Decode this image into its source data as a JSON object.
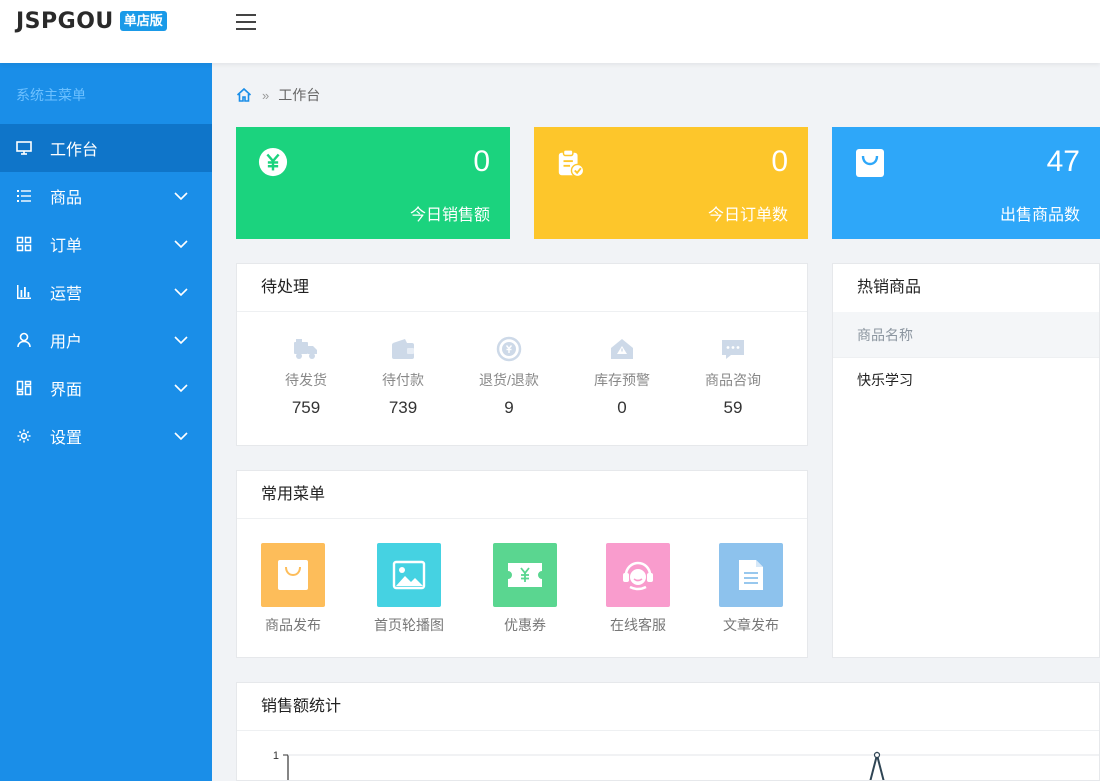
{
  "app": {
    "logo_text": "JSPGOU",
    "logo_badge": "单店版",
    "brand_color": "#1a8ee8"
  },
  "sidebar": {
    "title": "系统主菜单",
    "items": [
      {
        "label": "工作台",
        "icon": "monitor-icon",
        "active": true
      },
      {
        "label": "商品",
        "icon": "list-icon"
      },
      {
        "label": "订单",
        "icon": "grid-icon"
      },
      {
        "label": "运营",
        "icon": "bar-chart-icon"
      },
      {
        "label": "用户",
        "icon": "user-icon"
      },
      {
        "label": "界面",
        "icon": "layout-icon"
      },
      {
        "label": "设置",
        "icon": "gear-icon"
      }
    ]
  },
  "breadcrumb": {
    "icon": "home-icon",
    "separator": "»",
    "current": "工作台"
  },
  "stats": [
    {
      "value": "0",
      "label": "今日销售额",
      "color": "#1bd37e",
      "icon": "yen-icon"
    },
    {
      "value": "0",
      "label": "今日订单数",
      "color": "#fdc62b",
      "icon": "clipboard-check-icon"
    },
    {
      "value": "47",
      "label": "出售商品数",
      "color": "#2ea7f9",
      "icon": "shopping-bag-icon"
    }
  ],
  "pending": {
    "title": "待处理",
    "items": [
      {
        "label": "待发货",
        "value": "759",
        "icon": "truck-icon"
      },
      {
        "label": "待付款",
        "value": "739",
        "icon": "wallet-icon"
      },
      {
        "label": "退货/退款",
        "value": "9",
        "icon": "refund-icon"
      },
      {
        "label": "库存预警",
        "value": "0",
        "icon": "warning-icon"
      },
      {
        "label": "商品咨询",
        "value": "59",
        "icon": "chat-icon"
      }
    ]
  },
  "quick_menu": {
    "title": "常用菜单",
    "items": [
      {
        "label": "商品发布",
        "color": "#fdbd5a",
        "icon": "bag-icon"
      },
      {
        "label": "首页轮播图",
        "color": "#45d2e2",
        "icon": "image-icon"
      },
      {
        "label": "优惠券",
        "color": "#5ad690",
        "icon": "coupon-icon"
      },
      {
        "label": "在线客服",
        "color": "#f99ccd",
        "icon": "support-icon"
      },
      {
        "label": "文章发布",
        "color": "#8dc2ed",
        "icon": "document-icon"
      }
    ]
  },
  "hot_products": {
    "title": "热销商品",
    "column": "商品名称",
    "rows": [
      "快乐学习"
    ]
  },
  "sales_chart": {
    "title": "销售额统计"
  },
  "chart_data": {
    "type": "line",
    "title": "销售额统计",
    "y_ticks": [
      "1"
    ],
    "ylim": [
      0,
      1
    ],
    "series": [
      {
        "values": [
          0,
          1,
          0
        ]
      }
    ]
  }
}
